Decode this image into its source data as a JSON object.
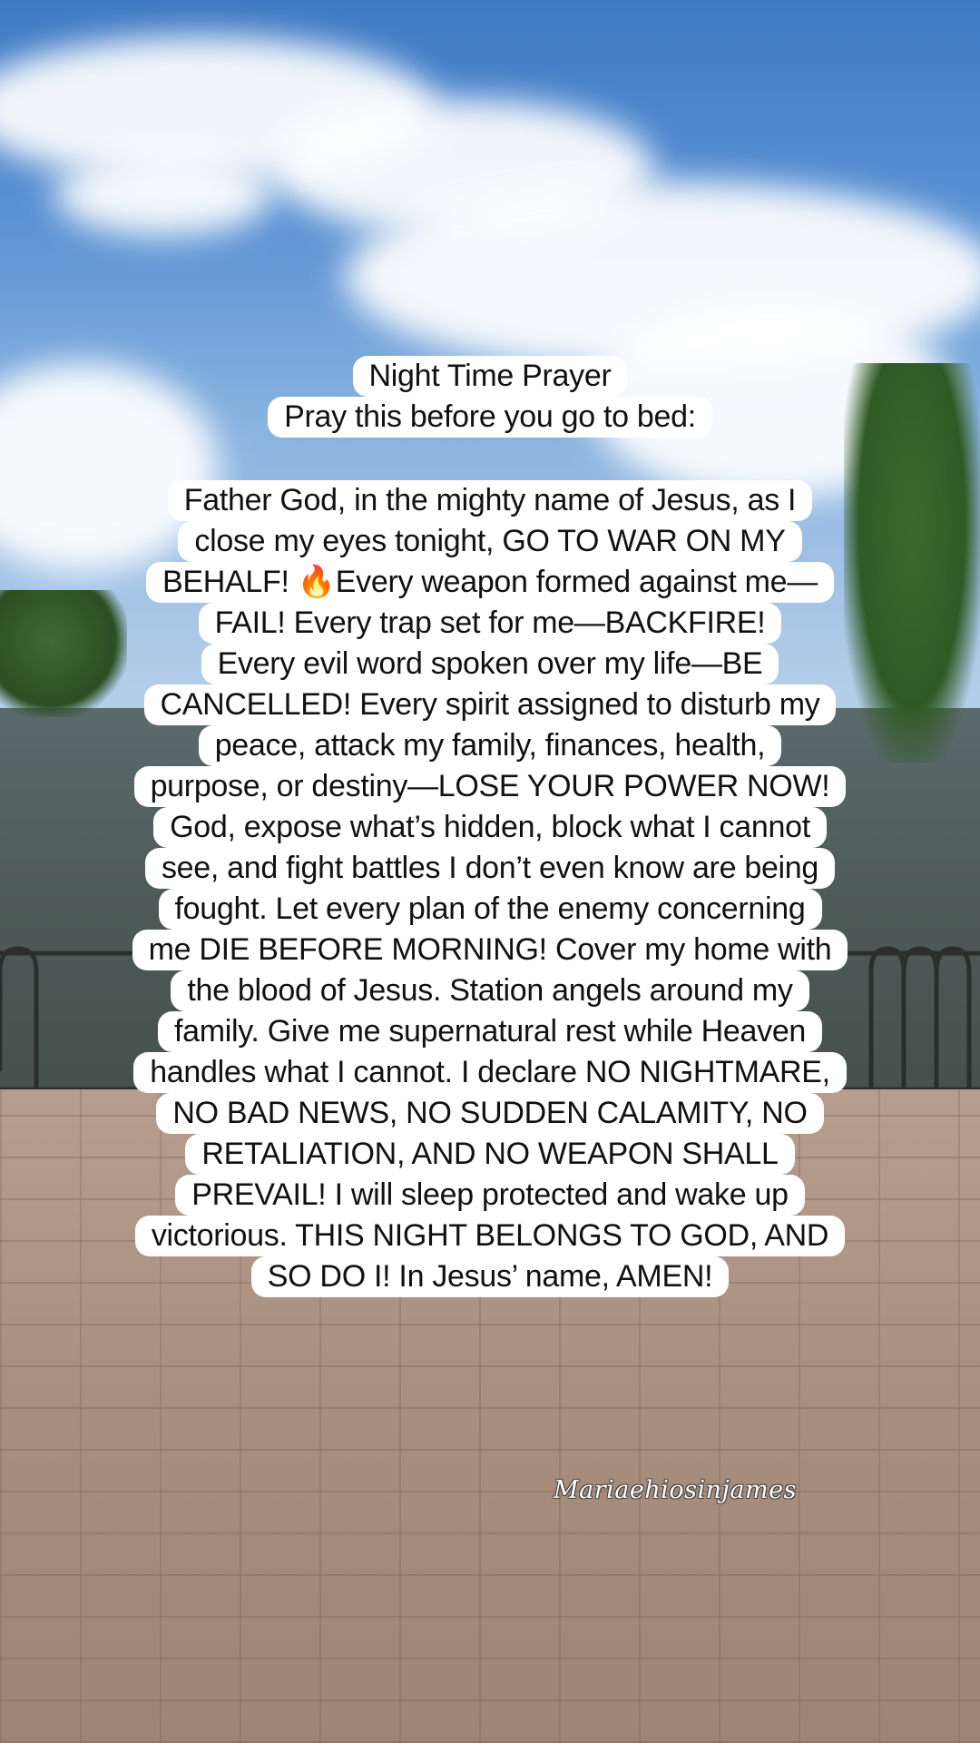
{
  "header": {
    "title": "Night Time Prayer",
    "subtitle": "Pray this before you go to bed:"
  },
  "prayer_lines": [
    "Father God, in the mighty name of Jesus, as I",
    "close my eyes tonight, GO TO WAR ON MY",
    "BEHALF! 🔥Every weapon formed against me—",
    "FAIL! Every trap set for me—BACKFIRE!",
    "Every evil word spoken over my life—BE",
    "CANCELLED! Every spirit assigned to disturb my",
    "peace, attack my family, finances, health,",
    "purpose, or destiny—LOSE YOUR POWER NOW!",
    "God, expose what’s hidden, block what I cannot",
    "see, and fight battles I don’t even know are being",
    "fought. Let every plan of the enemy concerning",
    "me DIE BEFORE MORNING! Cover my home with",
    "the blood of Jesus. Station angels around my",
    "family. Give me supernatural rest while Heaven",
    "handles what I cannot. I declare NO NIGHTMARE,",
    "NO BAD NEWS, NO SUDDEN CALAMITY, NO",
    "RETALIATION, AND NO WEAPON SHALL",
    "PREVAIL! I will sleep protected and wake up",
    "victorious. THIS NIGHT BELONGS TO GOD, AND",
    "SO DO I! In Jesus’ name, AMEN!"
  ],
  "watermark": "Mariaehiosinjames",
  "colors": {
    "caption_bg": "#ffffff",
    "caption_text": "#111111",
    "sky": "#4f86cc"
  }
}
